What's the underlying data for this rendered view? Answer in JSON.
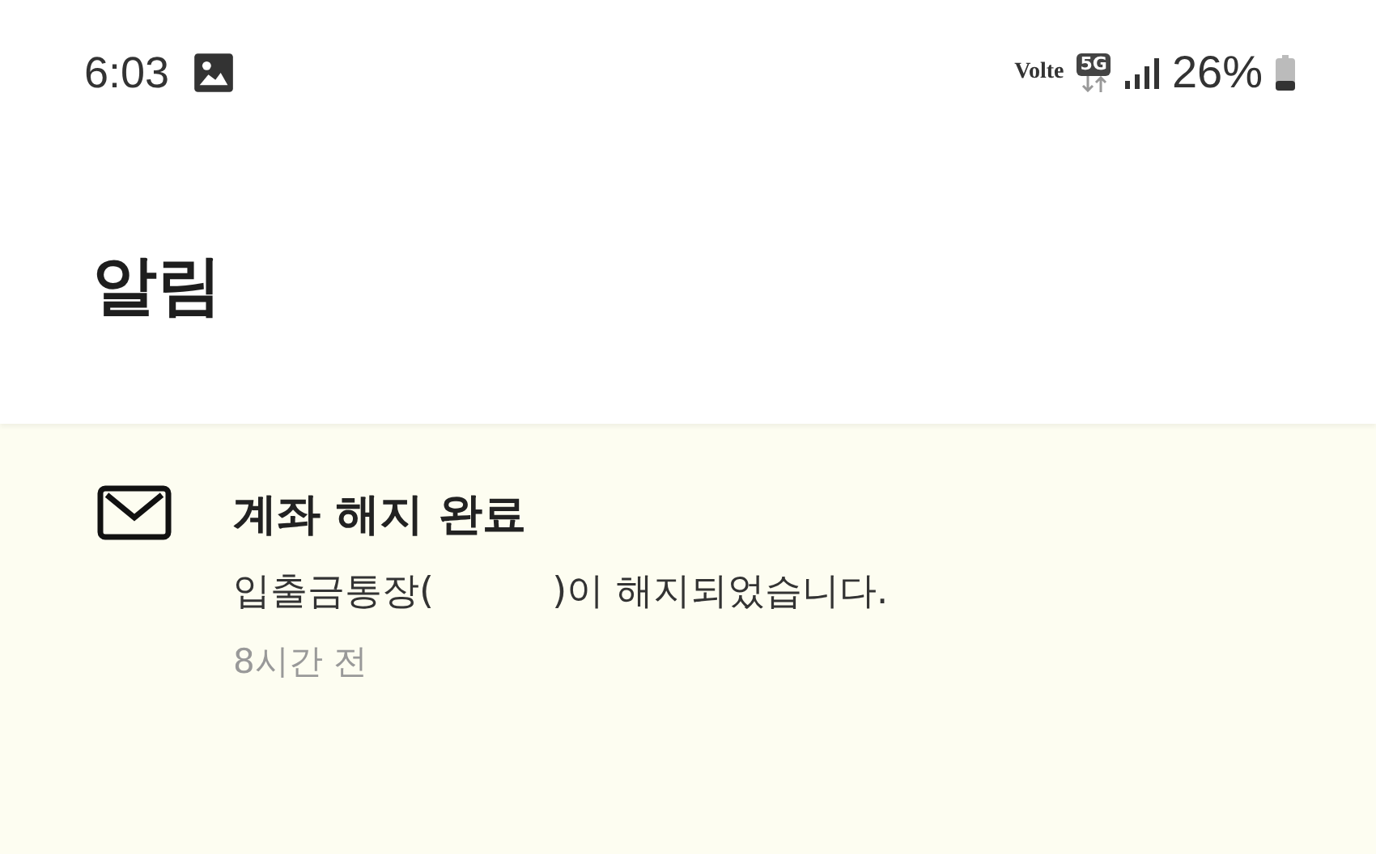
{
  "status_bar": {
    "time": "6:03",
    "volte": "Volte",
    "network": "5G",
    "battery": "26%"
  },
  "header": {
    "title": "알림"
  },
  "notifications": [
    {
      "kind": "mail",
      "unread": true,
      "title": "계좌 해지 완료",
      "message": "입출금통장(          )이 해지되었습니다.",
      "time": "8시간 전"
    }
  ]
}
